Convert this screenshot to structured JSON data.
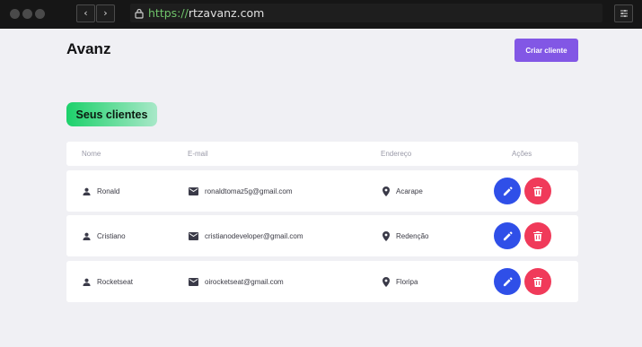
{
  "browser": {
    "url_scheme": "https://",
    "url_host": "rtzavanz.com"
  },
  "header": {
    "brand": "Avanz",
    "create_button": "Criar cliente"
  },
  "section": {
    "title": "Seus clientes"
  },
  "table": {
    "columns": {
      "name": "Nome",
      "email": "E-mail",
      "address": "Endereço",
      "actions": "Ações"
    },
    "rows": [
      {
        "name": "Ronald",
        "email": "ronaldtomaz5g@gmail.com",
        "address": "Acarape"
      },
      {
        "name": "Cristiano",
        "email": "cristianodeveloper@gmail.com",
        "address": "Redenção"
      },
      {
        "name": "Rocketseat",
        "email": "oirocketseat@gmail.com",
        "address": "Floripa"
      }
    ]
  },
  "icons": {
    "name": "person-icon",
    "email": "mail-icon",
    "address": "map-pin-icon",
    "edit": "pencil-icon",
    "delete": "trash-icon"
  },
  "colors": {
    "accent": "#8257e5",
    "edit": "#2f4fe8",
    "delete": "#f03a5a",
    "badge_start": "#1dd16b",
    "badge_end": "#a8e8c8"
  }
}
